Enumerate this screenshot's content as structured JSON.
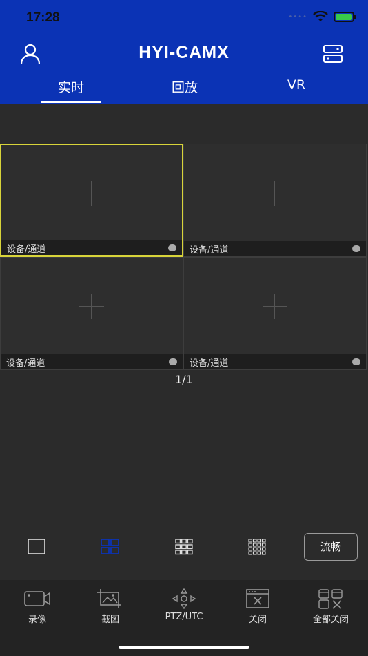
{
  "status_bar": {
    "time": "17:28",
    "icons": [
      "signal-dots-icon",
      "wifi-icon",
      "battery-charging-icon"
    ]
  },
  "header": {
    "title": "HYI-CAMX",
    "left_icon": "user-icon",
    "right_icon": "server-list-icon",
    "accent_color": "#0b33b5"
  },
  "tabs": [
    {
      "label": "实时",
      "active": true
    },
    {
      "label": "回放",
      "active": false
    },
    {
      "label": "VR",
      "active": false
    }
  ],
  "grid": {
    "cells": [
      {
        "label": "设备/通道",
        "selected": true
      },
      {
        "label": "设备/通道",
        "selected": false
      },
      {
        "label": "设备/通道",
        "selected": false
      },
      {
        "label": "设备/通道",
        "selected": false
      }
    ],
    "selected_color": "#d8d43a"
  },
  "pagination": {
    "text": "1/1"
  },
  "layout_options": [
    {
      "icon": "single-view-icon",
      "active": false
    },
    {
      "icon": "quad-view-icon",
      "active": true
    },
    {
      "icon": "nine-view-icon",
      "active": false
    },
    {
      "icon": "sixteen-view-icon",
      "active": false
    }
  ],
  "stream_button": {
    "label": "流畅"
  },
  "toolbar": [
    {
      "icon": "record-camera-icon",
      "label": "录像"
    },
    {
      "icon": "screenshot-icon",
      "label": "截图"
    },
    {
      "icon": "ptz-control-icon",
      "label": "PTZ/UTC"
    },
    {
      "icon": "close-window-icon",
      "label": "关闭"
    },
    {
      "icon": "close-all-icon",
      "label": "全部关闭"
    }
  ]
}
